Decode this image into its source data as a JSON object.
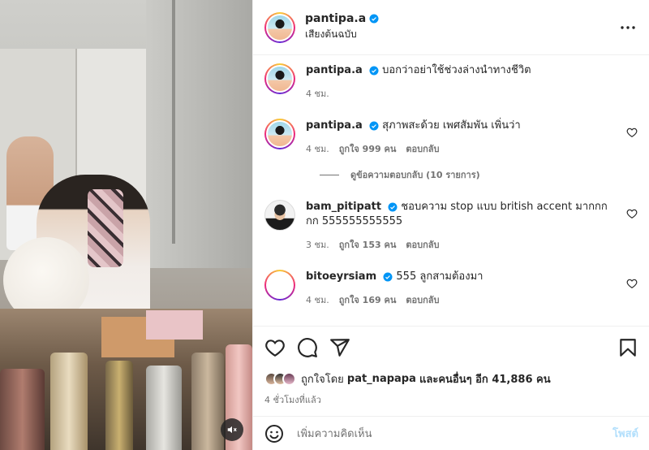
{
  "post": {
    "author": "pantipa.a",
    "audio": "เสียงต้นฉบับ",
    "caption": "บอกว่าอย่าใช้ช่วงล่างนำทางชีวิต",
    "caption_time": "4 ชม."
  },
  "comments": [
    {
      "username": "pantipa.a",
      "verified": true,
      "text": "สุภาพสะด้วย เพศสัมพัน เพิ่นว่า",
      "time": "4 ชม.",
      "likes": "ถูกใจ 999 คน",
      "reply": "ตอบกลับ",
      "view_replies": "ดูข้อความตอบกลับ (10 รายการ)"
    },
    {
      "username": "bam_pitipatt",
      "verified": true,
      "text": "ชอบความ stop แบบ british accent มากกกกก 555555555555",
      "time": "3 ชม.",
      "likes": "ถูกใจ 153 คน",
      "reply": "ตอบกลับ"
    },
    {
      "username": "bitoeyrsiam",
      "verified": true,
      "text": "555 ลูกสามต้องมา",
      "time": "4 ชม.",
      "likes": "ถูกใจ 169 คน",
      "reply": "ตอบกลับ"
    }
  ],
  "likes_summary": {
    "prefix": "ถูกใจโดย",
    "user": "pat_napapa",
    "suffix": "และคนอื่นๆ อีก 41,886 คน"
  },
  "post_age": "4 ชั่วโมงที่แล้ว",
  "add_comment": {
    "placeholder": "เพิ่มความคิดเห็น",
    "post_label": "โพสต์"
  },
  "colors": {
    "verified": "#0095f6",
    "post_button_disabled": "#b2dffc",
    "meta_text": "#737373"
  },
  "icons": [
    "more-icon",
    "heart-icon",
    "comment-icon",
    "share-icon",
    "bookmark-icon",
    "emoji-icon",
    "mute-icon",
    "verified-icon"
  ]
}
